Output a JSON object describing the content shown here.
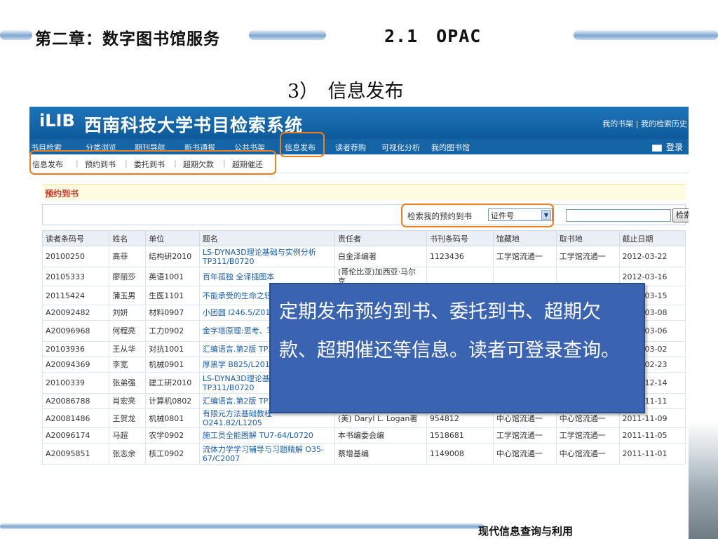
{
  "slide": {
    "chapter": "第二章：数字图书馆服务",
    "heading": "2.1　OPAC",
    "subtitle": "3）　信息发布",
    "footer": "现代信息查询与利用"
  },
  "app": {
    "logo": "iLIB",
    "site_name": "西南科技大学书目检索系统",
    "top_links": "我的书架 | 我的检索历史",
    "nav": [
      "书目检索",
      "分类浏览",
      "期刊导航",
      "新书通报",
      "公共书架",
      "信息发布",
      "读者荐购",
      "可视化分析",
      "我的图书馆"
    ],
    "login": "登录",
    "sub_nav": [
      "信息发布",
      "预约到书",
      "委托到书",
      "超期欠款",
      "超期催还"
    ],
    "panel_title": "预约到书",
    "search": {
      "label": "检索我的预约到书",
      "select_value": "证件号",
      "button": "检索"
    },
    "table": {
      "headers": [
        "读者条码号",
        "姓名",
        "单位",
        "题名",
        "责任者",
        "书刊条码号",
        "馆藏地",
        "取书地",
        "截止日期"
      ],
      "rows": [
        [
          "20100250",
          "高菲",
          "结构研2010",
          "LS-DYNA3D理论基础与实例分析 TP311/B0720",
          "白金泽编著",
          "1123436",
          "工学馆流通一",
          "工学馆流通一",
          "2012-03-22"
        ],
        [
          "20105333",
          "廖丽莎",
          "英语1001",
          "百年孤独 全译插图本",
          "(哥伦比亚)加西亚·马尔克",
          "",
          "",
          "",
          "2012-03-16"
        ],
        [
          "20115424",
          "蒲玉男",
          "生医1101",
          "不能承受的生命之轻",
          "",
          "",
          "",
          "",
          "2012-03-15"
        ],
        [
          "A20092482",
          "刘妍",
          "材料0907",
          "小团圆 I246.5/Z0109",
          "",
          "",
          "",
          "",
          "2012-03-08"
        ],
        [
          "A20096968",
          "何程亮",
          "工力0902",
          "金字塔原理:思考、写 锡 H052/M16",
          "",
          "",
          "",
          "",
          "2012-03-06"
        ],
        [
          "20103936",
          "王从华",
          "对抗1001",
          "汇编语言.第2版 TP31",
          "",
          "",
          "",
          "",
          "2012-03-02"
        ],
        [
          "A20094369",
          "李宽",
          "机械0901",
          "厚黑学 B825/L2017-",
          "",
          "",
          "",
          "",
          "2012-02-23"
        ],
        [
          "20100339",
          "张弟强",
          "建工研2010",
          "LS-DYNA3D理论基础与实例分析 TP311/B0720",
          "白金泽编著",
          "1123438",
          "工学馆流通一",
          "工学馆流通一",
          "2011-12-14"
        ],
        [
          "A20086788",
          "肖宏亮",
          "计算机0802",
          "汇编语言.第2版 TP313/W15",
          "王爽著",
          "1531381",
          "工学馆流通一",
          "工学馆流通一",
          "2011-11-11"
        ],
        [
          "A20081486",
          "王贺龙",
          "机械0801",
          "有限元方法基础教程 O241.82/L1205",
          "(美) Daryl L. Logan著",
          "954812",
          "中心馆流通一",
          "中心馆流通一",
          "2011-11-09"
        ],
        [
          "A20096174",
          "马超",
          "农学0902",
          "施工员全能图解 TU7-64/L0720",
          "本书编委会编",
          "1518681",
          "工学馆流通一",
          "工学馆流通一",
          "2011-11-05"
        ],
        [
          "A20095851",
          "张志余",
          "核工0902",
          "流体力学学习辅导与习题精解 O35-67/C2007",
          "蔡增基编",
          "1149008",
          "中心馆流通一",
          "中心馆流通一",
          "2011-11-01"
        ]
      ]
    }
  },
  "callout": "定期发布预约到书、委托到书、超期欠款、超期催还等信息。读者可登录查询。",
  "colors": {
    "highlight": "#ef7f1a",
    "callout_bg": "#3a63b1",
    "topbar": "#1565a6"
  }
}
